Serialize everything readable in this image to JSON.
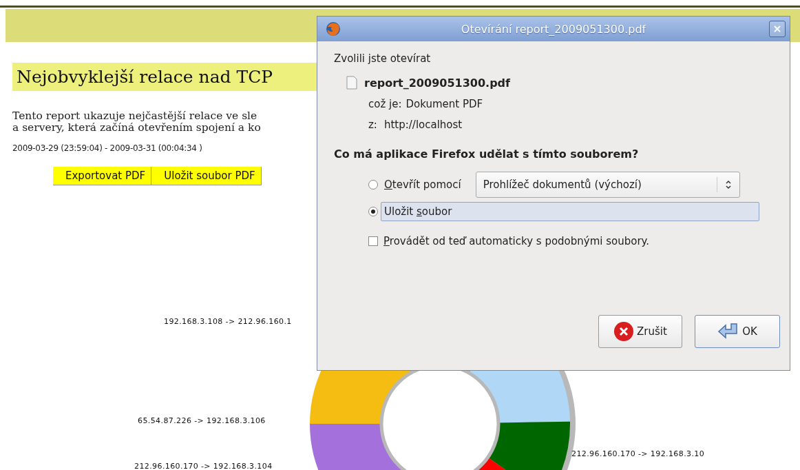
{
  "page": {
    "heading": "Nejobvyklejší relace nad TCP",
    "description": [
      "Tento report ukazuje nejčastější relace ve sle",
      "a servery, která začíná otevřením spojení a ko"
    ],
    "date_range": "2009-03-29 (23:59:04) - 2009-03-31 (00:04:34 )",
    "buttons": [
      "Exportovat PDF",
      "Uložit soubor PDF"
    ],
    "chart_labels": [
      "192.168.3.108 -> 212.96.160.1",
      "65.54.87.226 -> 192.168.3.106",
      "212.96.160.170 -> 192.168.3.104",
      "212.96.160.170 -> 192.168.3.10"
    ]
  },
  "dialog": {
    "title": "Otevírání report_2009051300.pdf",
    "intro": "Zvolili jste otevírat",
    "file_name": "report_2009051300.pdf",
    "type_label": "což je:",
    "type_value": "Dokument PDF",
    "from_label": "z:",
    "from_value": "http://localhost",
    "question": "Co má aplikace Firefox udělat s tímto souborem?",
    "options": [
      {
        "label": {
          "key": "O",
          "rest": "tevřít pomocí"
        },
        "selected": false,
        "app": "Prohlížeč dokumentů (výchozí)"
      },
      {
        "label": {
          "lead": "Uložit ",
          "key": "s",
          "rest": "oubor"
        },
        "selected": true
      }
    ],
    "remember": {
      "label": {
        "key": "P",
        "rest": "rovádět od teď automaticky s podobnými soubory."
      },
      "checked": false
    },
    "buttons": [
      {
        "kind": "cancel",
        "label": "Zrušit"
      },
      {
        "kind": "ok",
        "label": "OK"
      }
    ]
  }
}
